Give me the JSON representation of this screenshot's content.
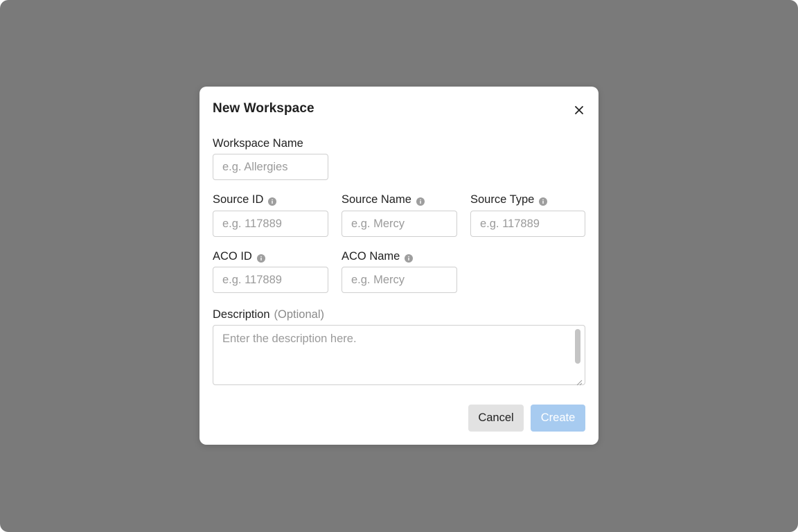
{
  "dialog": {
    "title": "New Workspace",
    "close_icon": "close-icon"
  },
  "fields": {
    "workspace_name": {
      "label": "Workspace Name",
      "placeholder": "e.g. Allergies",
      "value": ""
    },
    "source_id": {
      "label": "Source ID",
      "placeholder": "e.g. 117889",
      "value": "",
      "info_icon": "info-icon"
    },
    "source_name": {
      "label": "Source Name",
      "placeholder": "e.g. Mercy",
      "value": "",
      "info_icon": "info-icon"
    },
    "source_type": {
      "label": "Source Type",
      "placeholder": "e.g. 117889",
      "value": "",
      "info_icon": "info-icon"
    },
    "aco_id": {
      "label": "ACO ID",
      "placeholder": "e.g. 117889",
      "value": "",
      "info_icon": "info-icon"
    },
    "aco_name": {
      "label": "ACO Name",
      "placeholder": "e.g. Mercy",
      "value": "",
      "info_icon": "info-icon"
    },
    "description": {
      "label": "Description",
      "optional_label": "(Optional)",
      "placeholder": "Enter the description here.",
      "value": ""
    }
  },
  "actions": {
    "cancel_label": "Cancel",
    "create_label": "Create"
  },
  "colors": {
    "backdrop": "#7a7a7a",
    "create_button_disabled": "#a7cbf0",
    "cancel_button": "#e2e2e2",
    "info_icon": "#9e9e9e"
  }
}
